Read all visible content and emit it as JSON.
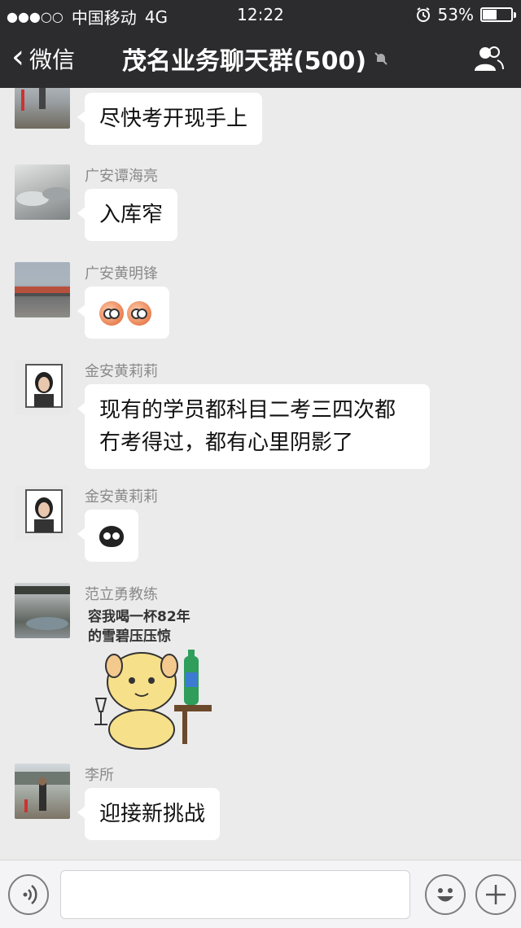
{
  "status": {
    "carrier": "中国移动",
    "network": "4G",
    "time": "12:22",
    "battery": "53%",
    "battery_level": 0.53
  },
  "nav": {
    "back_label": "微信",
    "title": "茂名业务聊天群(500)"
  },
  "messages": [
    {
      "sender": "",
      "text": "尽快考开现手上"
    },
    {
      "sender": "广安谭海亮",
      "text": "入库窄"
    },
    {
      "sender": "广安黄明锋",
      "emoji": "face-emoji-x2"
    },
    {
      "sender": "金安黄莉莉",
      "text_line1": "现有的学员都科目二考三四次都",
      "text_line2": "冇考得过，都有心里阴影了"
    },
    {
      "sender": "金安黄莉莉",
      "emoji": "owl-emoji"
    },
    {
      "sender": "范立勇教练",
      "sticker_line1": "容我喝一杯82年",
      "sticker_line2": "的雪碧压压惊"
    },
    {
      "sender": "李所",
      "text": "迎接新挑战"
    }
  ],
  "input": {
    "placeholder": ""
  },
  "colors": {
    "header_bg": "#2c2c2e",
    "chat_bg": "#ebebeb",
    "bubble_bg": "#ffffff"
  }
}
